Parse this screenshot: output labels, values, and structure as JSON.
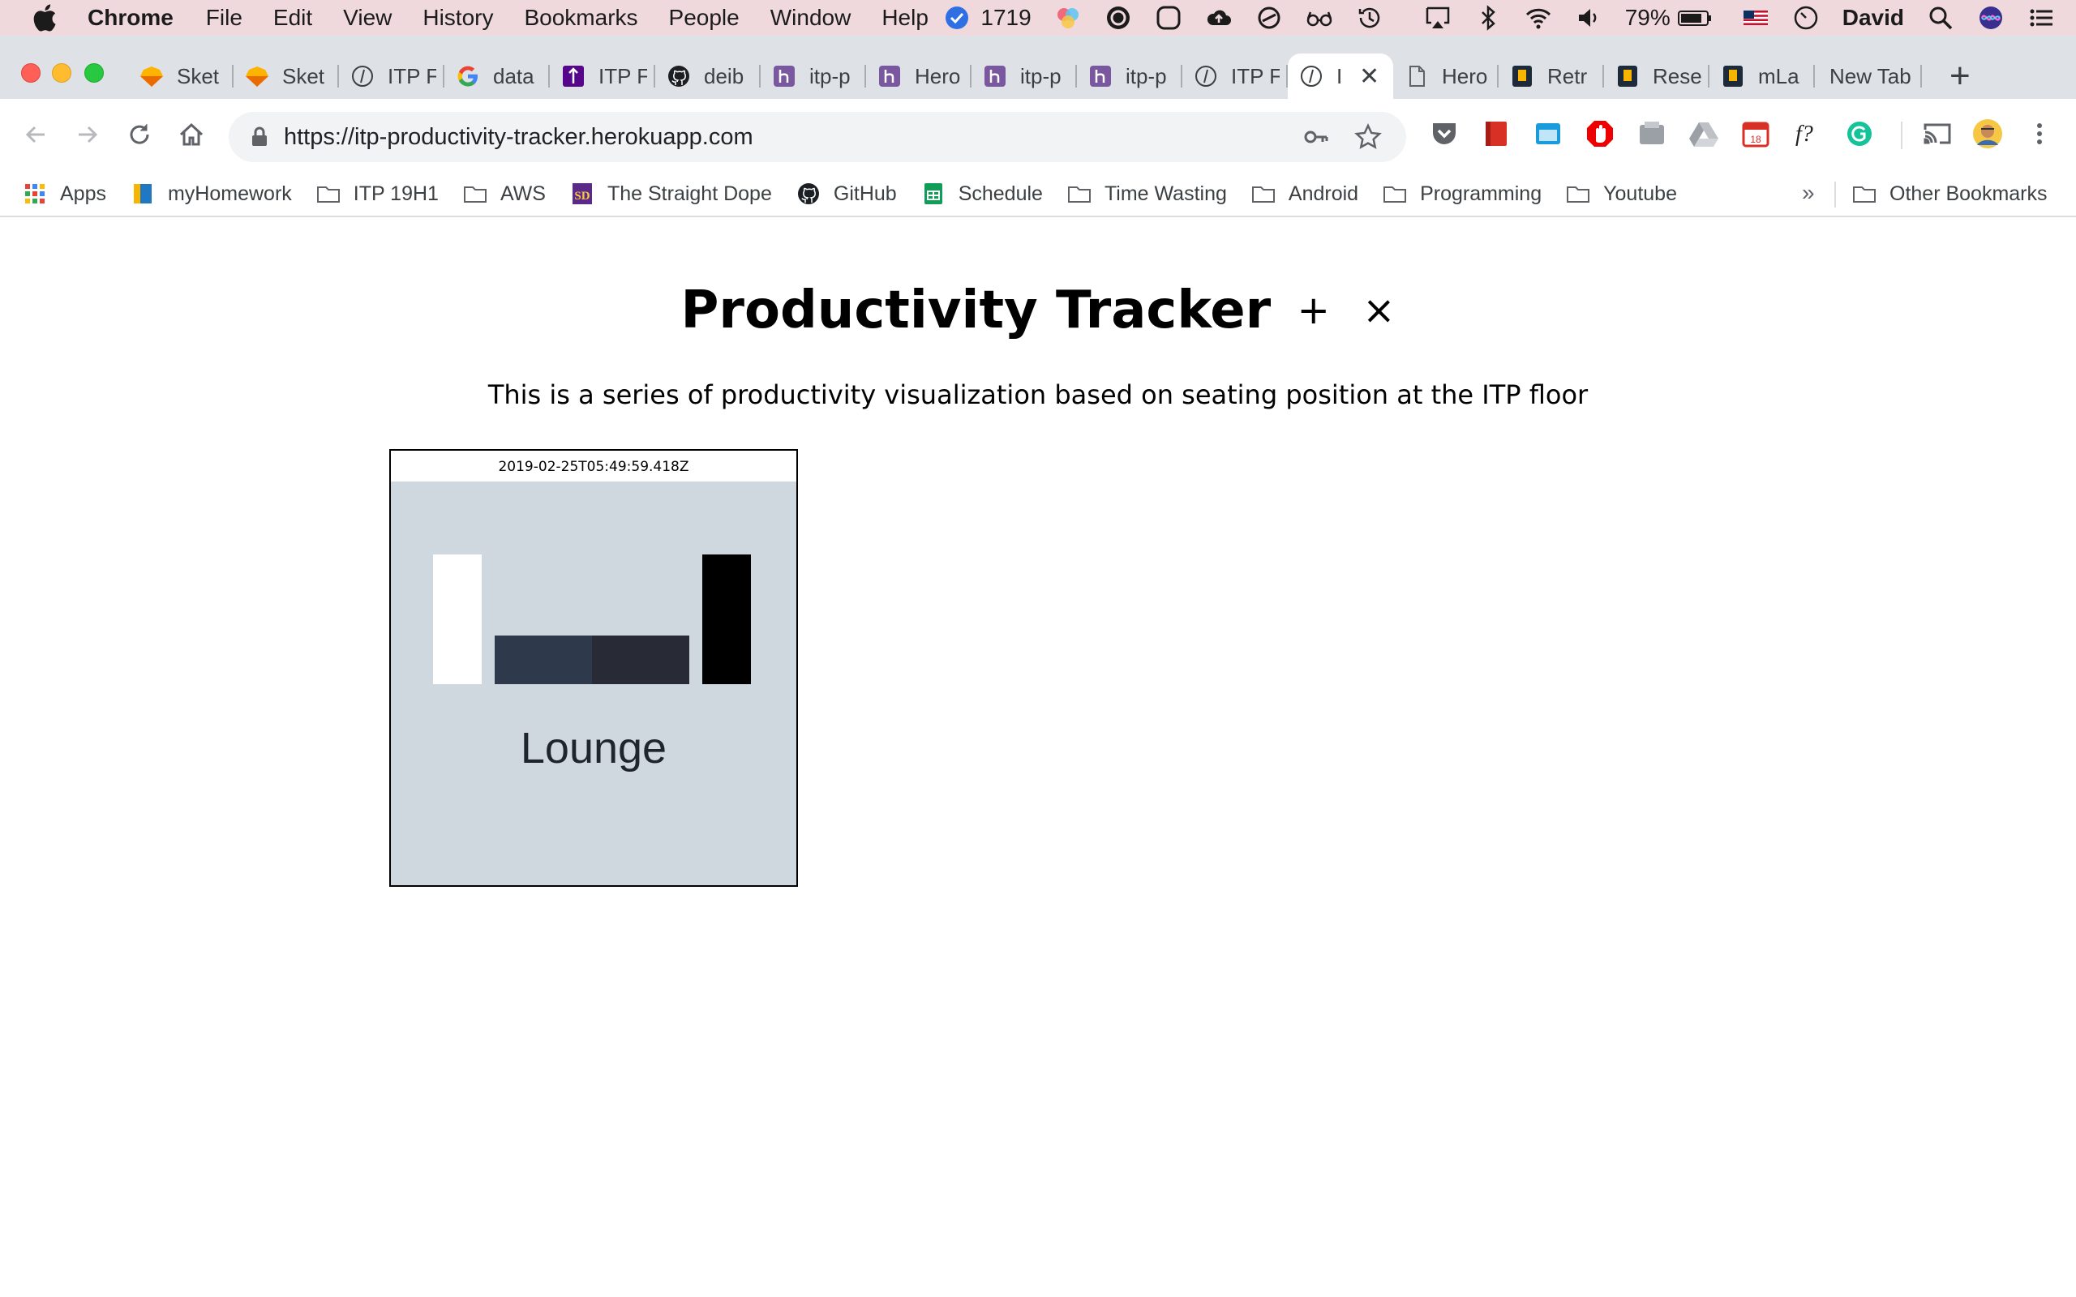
{
  "menubar": {
    "app": "Chrome",
    "items": [
      "File",
      "Edit",
      "View",
      "History",
      "Bookmarks",
      "People",
      "Window",
      "Help"
    ],
    "status_count": "1719",
    "battery": "79%",
    "user": "David",
    "icons": [
      "notification-badge-icon",
      "color-circles-icon",
      "creative-cloud-icon",
      "circle-icon",
      "cloud-upload-icon",
      "sync-icon",
      "glasses-icon",
      "time-machine-icon",
      "airplay-icon",
      "bluetooth-icon",
      "wifi-icon",
      "volume-icon",
      "battery-icon",
      "us-flag-icon",
      "clock-icon",
      "spotlight-icon",
      "siri-icon",
      "list-icon"
    ]
  },
  "tabs": [
    {
      "label": "Sket",
      "icon": "sketch-icon"
    },
    {
      "label": "Sket",
      "icon": "sketch-icon"
    },
    {
      "label": "ITP F",
      "icon": "itp-icon"
    },
    {
      "label": "data",
      "icon": "google-icon"
    },
    {
      "label": "ITP F",
      "icon": "itp-purple-icon"
    },
    {
      "label": "deib",
      "icon": "github-icon"
    },
    {
      "label": "itp-p",
      "icon": "heroku-icon"
    },
    {
      "label": "Hero",
      "icon": "heroku-icon"
    },
    {
      "label": "itp-p",
      "icon": "heroku-icon"
    },
    {
      "label": "itp-p",
      "icon": "heroku-icon"
    },
    {
      "label": "ITP F",
      "icon": "itp-icon"
    },
    {
      "label": "I",
      "icon": "itp-icon",
      "active": true
    },
    {
      "label": "Hero",
      "icon": "page-icon"
    },
    {
      "label": "Retr",
      "icon": "bookmark-app-icon"
    },
    {
      "label": "Rese",
      "icon": "bookmark-app-icon"
    },
    {
      "label": "mLa",
      "icon": "bookmark-app-icon"
    },
    {
      "label": "New Tab",
      "icon": ""
    }
  ],
  "toolbar": {
    "url": "https://itp-productivity-tracker.herokuapp.com",
    "extensions": [
      "pocket-icon",
      "red-book-icon",
      "screenshot-icon",
      "adblock-icon",
      "grey-box-icon",
      "drive-icon",
      "calendar-icon",
      "font-icon",
      "grammarly-icon",
      "cast-icon",
      "profile-avatar-icon",
      "more-icon"
    ]
  },
  "bookmarks": {
    "items": [
      {
        "label": "Apps",
        "icon": "apps-grid-icon"
      },
      {
        "label": "myHomework",
        "icon": "myhomework-icon"
      },
      {
        "label": "ITP 19H1",
        "icon": "folder-icon"
      },
      {
        "label": "AWS",
        "icon": "folder-icon"
      },
      {
        "label": "The Straight Dope",
        "icon": "sd-icon"
      },
      {
        "label": "GitHub",
        "icon": "github-icon"
      },
      {
        "label": "Schedule",
        "icon": "sheets-icon"
      },
      {
        "label": "Time Wasting",
        "icon": "folder-icon"
      },
      {
        "label": "Android",
        "icon": "folder-icon"
      },
      {
        "label": "Programming",
        "icon": "folder-icon"
      },
      {
        "label": "Youtube",
        "icon": "folder-icon"
      }
    ],
    "more": "»",
    "other": "Other Bookmarks"
  },
  "page": {
    "title": "Productivity Tracker",
    "add_symbol": "+",
    "close_symbol": "×",
    "subtitle": "This is a series of productivity visualization based on seating position at the ITP floor",
    "card": {
      "timestamp": "2019-02-25T05:49:59.418Z",
      "label": "Lounge",
      "background": "#cfd8df",
      "bars": [
        {
          "color": "#ffffff"
        },
        {
          "color": "#2e3a4b"
        },
        {
          "color": "#282a36"
        },
        {
          "color": "#000000"
        }
      ]
    }
  }
}
